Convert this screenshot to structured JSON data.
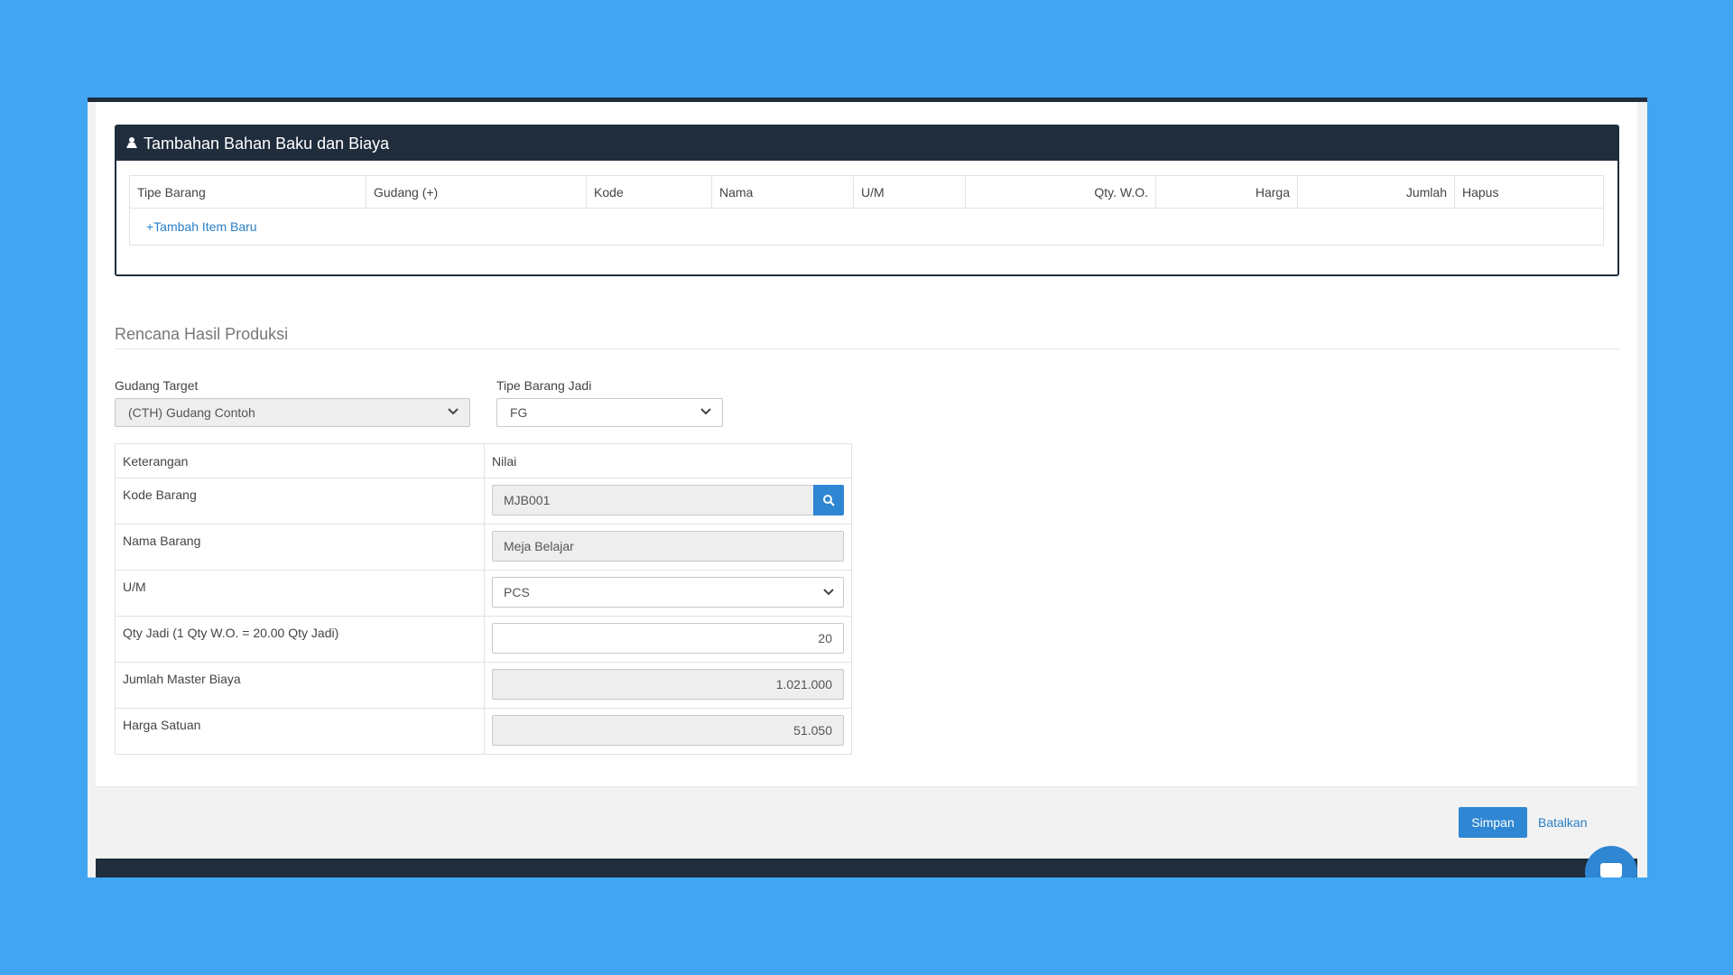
{
  "panel": {
    "title": "Tambahan Bahan Baku dan Biaya",
    "columns": [
      "Tipe Barang",
      "Gudang (+)",
      "Kode",
      "Nama",
      "U/M",
      "Qty. W.O.",
      "Harga",
      "Jumlah",
      "Hapus"
    ],
    "add_item_label": "+Tambah Item Baru"
  },
  "section": {
    "title": "Rencana Hasil Produksi"
  },
  "gudang_target": {
    "label": "Gudang Target",
    "value": "(CTH) Gudang Contoh"
  },
  "tipe_barang_jadi": {
    "label": "Tipe Barang Jadi",
    "value": "FG"
  },
  "detail": {
    "header_key": "Keterangan",
    "header_value": "Nilai",
    "rows": [
      {
        "label": "Kode Barang",
        "value": "MJB001"
      },
      {
        "label": "Nama Barang",
        "value": "Meja Belajar"
      },
      {
        "label": "U/M",
        "value": "PCS"
      },
      {
        "label": "Qty Jadi (1 Qty W.O. = 20.00 Qty Jadi)",
        "value": "20"
      },
      {
        "label": "Jumlah Master Biaya",
        "value": "1.021.000"
      },
      {
        "label": "Harga Satuan",
        "value": "51.050"
      }
    ]
  },
  "footer": {
    "save_label": "Simpan",
    "cancel_label": "Batalkan"
  },
  "colors": {
    "background": "#42a5f2",
    "header_dark": "#1f2d3d",
    "primary": "#2f86d3",
    "link": "#2a7fc8"
  }
}
